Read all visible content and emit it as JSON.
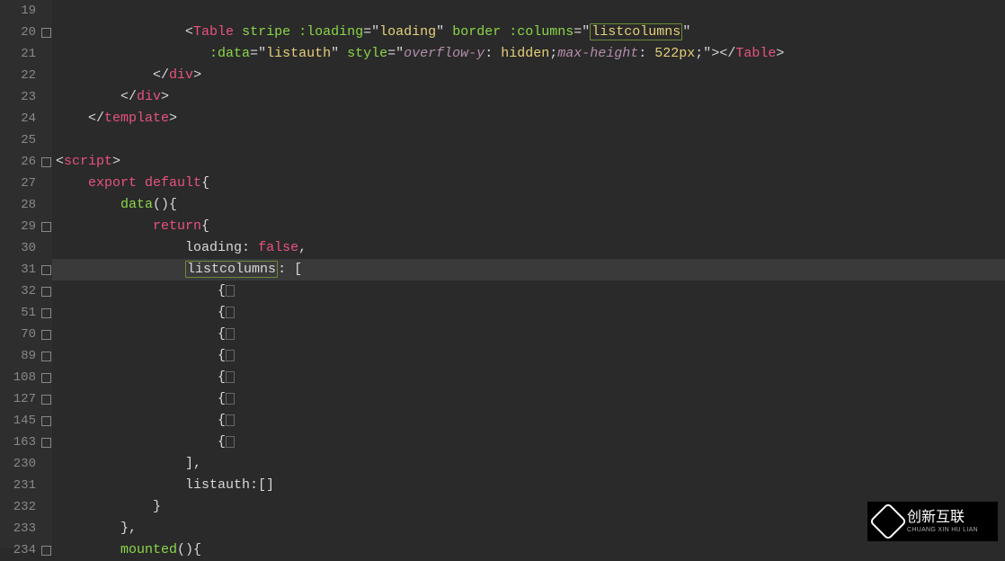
{
  "logo": {
    "text_cn": "创新互联",
    "text_en": "CHUANG XIN HU LIAN"
  },
  "highlight_term": "listcolumns",
  "active_line": 31,
  "lines": [
    {
      "num": 19,
      "fold": "none",
      "indent": "            ",
      "tokens": []
    },
    {
      "num": 20,
      "fold": "m",
      "indent": "                ",
      "tokens": [
        {
          "c": "t-punc",
          "t": "<"
        },
        {
          "c": "t-tag",
          "t": "Table"
        },
        {
          "c": "t-plain",
          "t": " "
        },
        {
          "c": "t-attr",
          "t": "stripe"
        },
        {
          "c": "t-plain",
          "t": " "
        },
        {
          "c": "t-attr",
          "t": ":loading"
        },
        {
          "c": "t-punc",
          "t": "="
        },
        {
          "c": "t-punc",
          "t": "\""
        },
        {
          "c": "t-str",
          "t": "loading"
        },
        {
          "c": "t-punc",
          "t": "\""
        },
        {
          "c": "t-plain",
          "t": " "
        },
        {
          "c": "t-attr",
          "t": "border"
        },
        {
          "c": "t-plain",
          "t": " "
        },
        {
          "c": "t-attr",
          "t": ":columns"
        },
        {
          "c": "t-punc",
          "t": "="
        },
        {
          "c": "t-punc",
          "t": "\""
        },
        {
          "c": "t-str",
          "t": "listcolumns",
          "hl": true
        },
        {
          "c": "t-punc",
          "t": "\""
        }
      ]
    },
    {
      "num": 21,
      "fold": "none",
      "indent": "                   ",
      "tokens": [
        {
          "c": "t-attr",
          "t": ":data"
        },
        {
          "c": "t-punc",
          "t": "="
        },
        {
          "c": "t-punc",
          "t": "\""
        },
        {
          "c": "t-str",
          "t": "listauth"
        },
        {
          "c": "t-punc",
          "t": "\""
        },
        {
          "c": "t-plain",
          "t": " "
        },
        {
          "c": "t-attr",
          "t": "style"
        },
        {
          "c": "t-punc",
          "t": "="
        },
        {
          "c": "t-punc",
          "t": "\""
        },
        {
          "c": "t-val",
          "t": "overflow-y"
        },
        {
          "c": "t-punc",
          "t": ": "
        },
        {
          "c": "t-str",
          "t": "hidden"
        },
        {
          "c": "t-punc",
          "t": ";"
        },
        {
          "c": "t-val",
          "t": "max-height"
        },
        {
          "c": "t-punc",
          "t": ": "
        },
        {
          "c": "t-str",
          "t": "522px"
        },
        {
          "c": "t-punc",
          "t": ";"
        },
        {
          "c": "t-punc",
          "t": "\""
        },
        {
          "c": "t-punc",
          "t": ">"
        },
        {
          "c": "t-punc",
          "t": "</"
        },
        {
          "c": "t-tag",
          "t": "Table"
        },
        {
          "c": "t-punc",
          "t": ">"
        }
      ]
    },
    {
      "num": 22,
      "fold": "none",
      "indent": "            ",
      "tokens": [
        {
          "c": "t-punc",
          "t": "</"
        },
        {
          "c": "t-tag",
          "t": "div"
        },
        {
          "c": "t-punc",
          "t": ">"
        }
      ]
    },
    {
      "num": 23,
      "fold": "none",
      "indent": "        ",
      "tokens": [
        {
          "c": "t-punc",
          "t": "</"
        },
        {
          "c": "t-tag",
          "t": "div"
        },
        {
          "c": "t-punc",
          "t": ">"
        }
      ]
    },
    {
      "num": 24,
      "fold": "none",
      "indent": "    ",
      "tokens": [
        {
          "c": "t-punc",
          "t": "</"
        },
        {
          "c": "t-tag",
          "t": "template"
        },
        {
          "c": "t-punc",
          "t": ">"
        }
      ]
    },
    {
      "num": 25,
      "fold": "none",
      "indent": "",
      "tokens": []
    },
    {
      "num": 26,
      "fold": "m",
      "indent": "",
      "tokens": [
        {
          "c": "t-punc",
          "t": "<"
        },
        {
          "c": "t-tag",
          "t": "script"
        },
        {
          "c": "t-punc",
          "t": ">"
        }
      ]
    },
    {
      "num": 27,
      "fold": "none",
      "indent": "    ",
      "tokens": [
        {
          "c": "t-kw",
          "t": "export"
        },
        {
          "c": "t-plain",
          "t": " "
        },
        {
          "c": "t-kw",
          "t": "default"
        },
        {
          "c": "t-punc",
          "t": "{"
        }
      ]
    },
    {
      "num": 28,
      "fold": "none",
      "indent": "        ",
      "tokens": [
        {
          "c": "t-attr",
          "t": "data"
        },
        {
          "c": "t-punc",
          "t": "(){"
        }
      ]
    },
    {
      "num": 29,
      "fold": "m",
      "indent": "            ",
      "tokens": [
        {
          "c": "t-kw",
          "t": "return"
        },
        {
          "c": "t-punc",
          "t": "{"
        }
      ]
    },
    {
      "num": 30,
      "fold": "none",
      "indent": "                ",
      "tokens": [
        {
          "c": "t-ident",
          "t": "loading"
        },
        {
          "c": "t-punc",
          "t": ": "
        },
        {
          "c": "t-kw",
          "t": "false"
        },
        {
          "c": "t-punc",
          "t": ","
        }
      ]
    },
    {
      "num": 31,
      "fold": "m",
      "indent": "                ",
      "hl": true,
      "tokens": [
        {
          "c": "t-ident",
          "t": "listcolumns",
          "hl": true
        },
        {
          "c": "t-punc",
          "t": ": ["
        }
      ]
    },
    {
      "num": 32,
      "fold": "m",
      "indent": "                    ",
      "tokens": [
        {
          "c": "t-punc",
          "t": "{"
        },
        {
          "foldbox": true
        }
      ]
    },
    {
      "num": 51,
      "fold": "m",
      "indent": "                    ",
      "tokens": [
        {
          "c": "t-punc",
          "t": "{"
        },
        {
          "foldbox": true
        }
      ]
    },
    {
      "num": 70,
      "fold": "m",
      "indent": "                    ",
      "tokens": [
        {
          "c": "t-punc",
          "t": "{"
        },
        {
          "foldbox": true
        }
      ]
    },
    {
      "num": 89,
      "fold": "m",
      "indent": "                    ",
      "tokens": [
        {
          "c": "t-punc",
          "t": "{"
        },
        {
          "foldbox": true
        }
      ]
    },
    {
      "num": 108,
      "fold": "m",
      "indent": "                    ",
      "tokens": [
        {
          "c": "t-punc",
          "t": "{"
        },
        {
          "foldbox": true
        }
      ]
    },
    {
      "num": 127,
      "fold": "m",
      "indent": "                    ",
      "tokens": [
        {
          "c": "t-punc",
          "t": "{"
        },
        {
          "foldbox": true
        }
      ]
    },
    {
      "num": 145,
      "fold": "m",
      "indent": "                    ",
      "tokens": [
        {
          "c": "t-punc",
          "t": "{"
        },
        {
          "foldbox": true
        }
      ]
    },
    {
      "num": 163,
      "fold": "m",
      "indent": "                    ",
      "tokens": [
        {
          "c": "t-punc",
          "t": "{"
        },
        {
          "foldbox": true
        }
      ]
    },
    {
      "num": 230,
      "fold": "none",
      "indent": "                ",
      "tokens": [
        {
          "c": "t-punc",
          "t": "],"
        }
      ]
    },
    {
      "num": 231,
      "fold": "none",
      "indent": "                ",
      "tokens": [
        {
          "c": "t-ident",
          "t": "listauth"
        },
        {
          "c": "t-punc",
          "t": ":[]"
        }
      ]
    },
    {
      "num": 232,
      "fold": "none",
      "indent": "            ",
      "tokens": [
        {
          "c": "t-punc",
          "t": "}"
        }
      ]
    },
    {
      "num": 233,
      "fold": "none",
      "indent": "        ",
      "tokens": [
        {
          "c": "t-punc",
          "t": "},"
        }
      ]
    },
    {
      "num": 234,
      "fold": "m",
      "indent": "        ",
      "tokens": [
        {
          "c": "t-attr",
          "t": "mounted"
        },
        {
          "c": "t-punc",
          "t": "(){"
        }
      ]
    }
  ]
}
